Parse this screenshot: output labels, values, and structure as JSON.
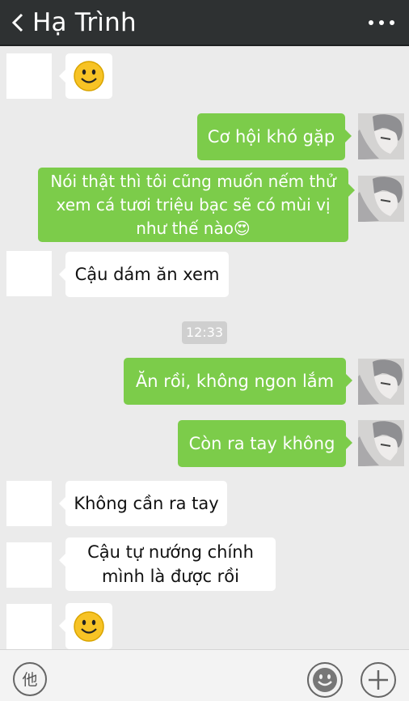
{
  "header": {
    "title": "Hạ Trình",
    "back_icon": "chevron-left-icon",
    "more_icon": "more-horizontal-icon"
  },
  "messages": [
    {
      "sender": "contact",
      "type": "emoji",
      "emoji": "smiley-face-icon"
    },
    {
      "sender": "me",
      "type": "text",
      "text": "Cơ hội khó gặp"
    },
    {
      "sender": "me",
      "type": "text",
      "lines": [
        "Nói thật thì tôi cũng muốn nếm thử",
        "xem cá tươi triệu bạc sẽ có mùi vị",
        "như thế nào😍"
      ]
    },
    {
      "sender": "contact",
      "type": "text",
      "text": "Cậu dám ăn xem"
    },
    {
      "type": "timestamp",
      "text": "12:33"
    },
    {
      "sender": "me",
      "type": "text",
      "text": "Ăn rồi, không ngon lắm"
    },
    {
      "sender": "me",
      "type": "text",
      "text": "Còn ra tay không"
    },
    {
      "sender": "contact",
      "type": "text",
      "text": "Không cần ra tay"
    },
    {
      "sender": "contact",
      "type": "text",
      "lines": [
        "Cậu tự nướng chính",
        "mình là được rồi"
      ]
    },
    {
      "sender": "contact",
      "type": "emoji",
      "emoji": "smiley-face-icon"
    }
  ],
  "input_bar": {
    "voice_label": "他",
    "emoji_icon": "emoji-icon",
    "plus_icon": "plus-icon"
  },
  "colors": {
    "header_bg": "#2e3132",
    "chat_bg": "#ebebeb",
    "outgoing_bubble": "#7ccc4a",
    "incoming_bubble": "#ffffff"
  }
}
